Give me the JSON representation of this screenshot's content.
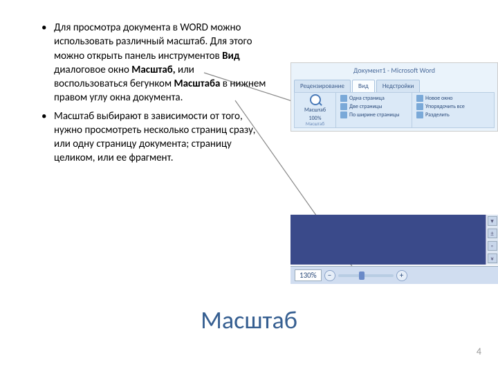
{
  "bullets": [
    {
      "pre": "Для просмотра документа в WORD можно использовать различный масштаб. Для этого можно открыть панель инструментов ",
      "b1": "Вид",
      "mid1": " диалоговое окно ",
      "b2": "Масштаб,",
      "mid2": " или воспользоваться бегунком ",
      "b3": "Масштаба",
      "post": " в нижнем правом углу окна документа."
    },
    {
      "pre": "Масштаб выбирают в зависимости от того, нужно просмотреть несколько страниц сразу, или одну страницу документа; страницу целиком, или ее фрагмент.",
      "b1": "",
      "mid1": "",
      "b2": "",
      "mid2": "",
      "b3": "",
      "post": ""
    }
  ],
  "ribbon": {
    "title": "Документ1 - Microsoft Word",
    "tabs": {
      "t1": "Рецензирование",
      "t2": "Вид",
      "t3": "Недстройки"
    },
    "scale_btn": "Масштаб",
    "pct": "100%",
    "one_page": "Одна страница",
    "two_pages": "Две страницы",
    "page_width": "По ширине страницы",
    "new_window": "Новое окно",
    "arrange": "Упорядочить все",
    "split": "Разделить",
    "group_label": "Масштаб"
  },
  "zoom": {
    "pct": "130%",
    "minus": "−",
    "plus": "+",
    "sb1": "▾",
    "sb2": "±",
    "sb3": "◦",
    "sb4": "¥"
  },
  "title": "Масштаб",
  "page": "4"
}
